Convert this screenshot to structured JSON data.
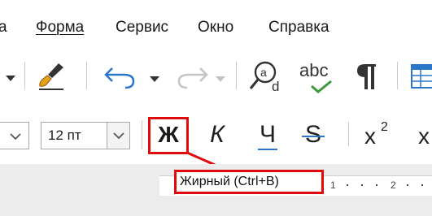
{
  "menu": {
    "items": [
      {
        "label": "а"
      },
      {
        "label": "Форма"
      },
      {
        "label": "Сервис"
      },
      {
        "label": "Окно"
      },
      {
        "label": "Справка"
      }
    ]
  },
  "toolbar2": {
    "font_size_value": "12 пт",
    "bold_label": "Ж",
    "italic_label": "К",
    "underline_label": "Ч",
    "strike_label": "S",
    "superscript_base": "x",
    "superscript_exp": "2",
    "subscript_base": "x"
  },
  "toolbar1": {
    "spelling_label": "abc"
  },
  "tooltip": {
    "text": "Жирный (Ctrl+B)"
  },
  "ruler": {
    "labels": [
      "1",
      "2"
    ]
  },
  "colors": {
    "highlight": "#e10a0a",
    "accent_blue": "#2a77c9",
    "accent_green": "#3c9a3c"
  },
  "icons": [
    "dropdown-arrow-icon",
    "clone-formatting-icon",
    "undo-icon",
    "redo-icon",
    "find-replace-icon",
    "spelling-icon",
    "formatting-marks-icon",
    "table-icon"
  ]
}
